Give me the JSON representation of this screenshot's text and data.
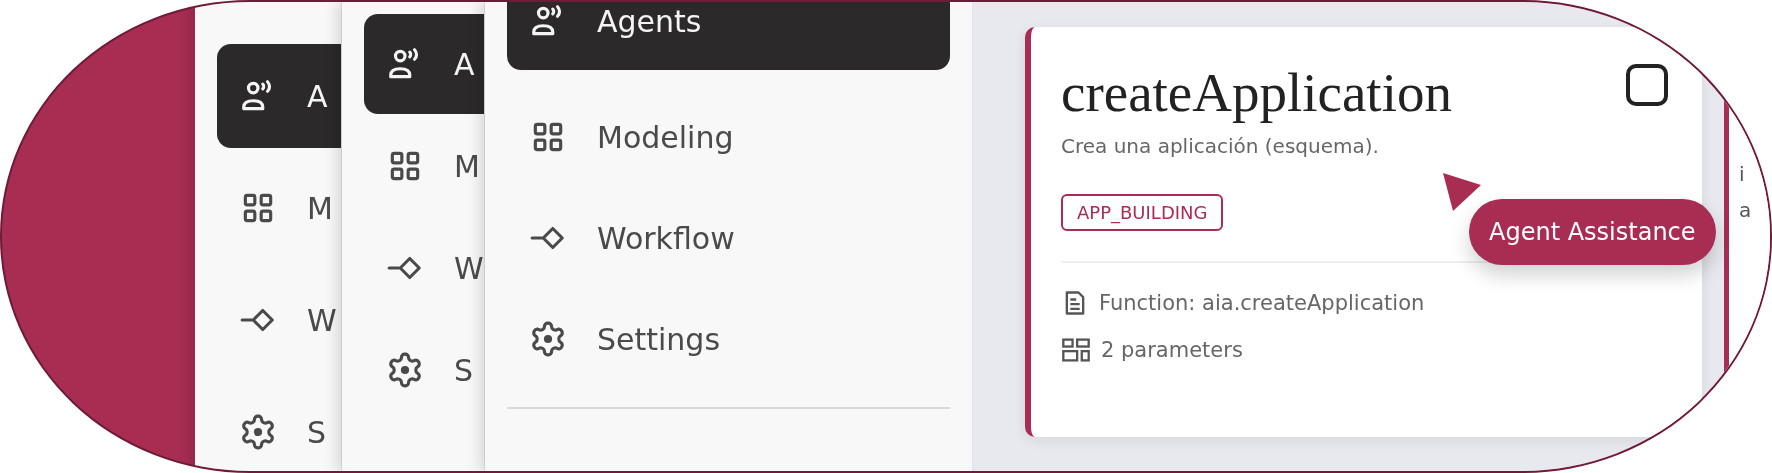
{
  "sidebars": [
    {
      "items": [
        {
          "label": "A",
          "kind": "agents",
          "selected": true
        },
        {
          "label": "M",
          "kind": "grid",
          "selected": false
        },
        {
          "label": "W",
          "kind": "workflow",
          "selected": false
        },
        {
          "label": "S",
          "kind": "gear",
          "selected": false
        }
      ]
    },
    {
      "items": [
        {
          "label": "A",
          "kind": "agents",
          "selected": true
        },
        {
          "label": "M",
          "kind": "grid",
          "selected": false
        },
        {
          "label": "W",
          "kind": "workflow",
          "selected": false
        },
        {
          "label": "S",
          "kind": "gear",
          "selected": false
        }
      ]
    },
    {
      "items": [
        {
          "label": "Agents",
          "kind": "agents",
          "selected": true
        },
        {
          "label": "Modeling",
          "kind": "grid",
          "selected": false
        },
        {
          "label": "Workflow",
          "kind": "workflow",
          "selected": false
        },
        {
          "label": "Settings",
          "kind": "gear",
          "selected": false
        }
      ]
    }
  ],
  "card": {
    "title": "createApplication",
    "checked": false,
    "description": "Crea una aplicación (esquema).",
    "tag": "APP_BUILDING",
    "function": "Function: aia.createApplication",
    "parameters": "2 parameters"
  },
  "tooltip": {
    "label": "Agent Assistance"
  },
  "next_card": {
    "lines": [
      "i",
      "a"
    ]
  }
}
